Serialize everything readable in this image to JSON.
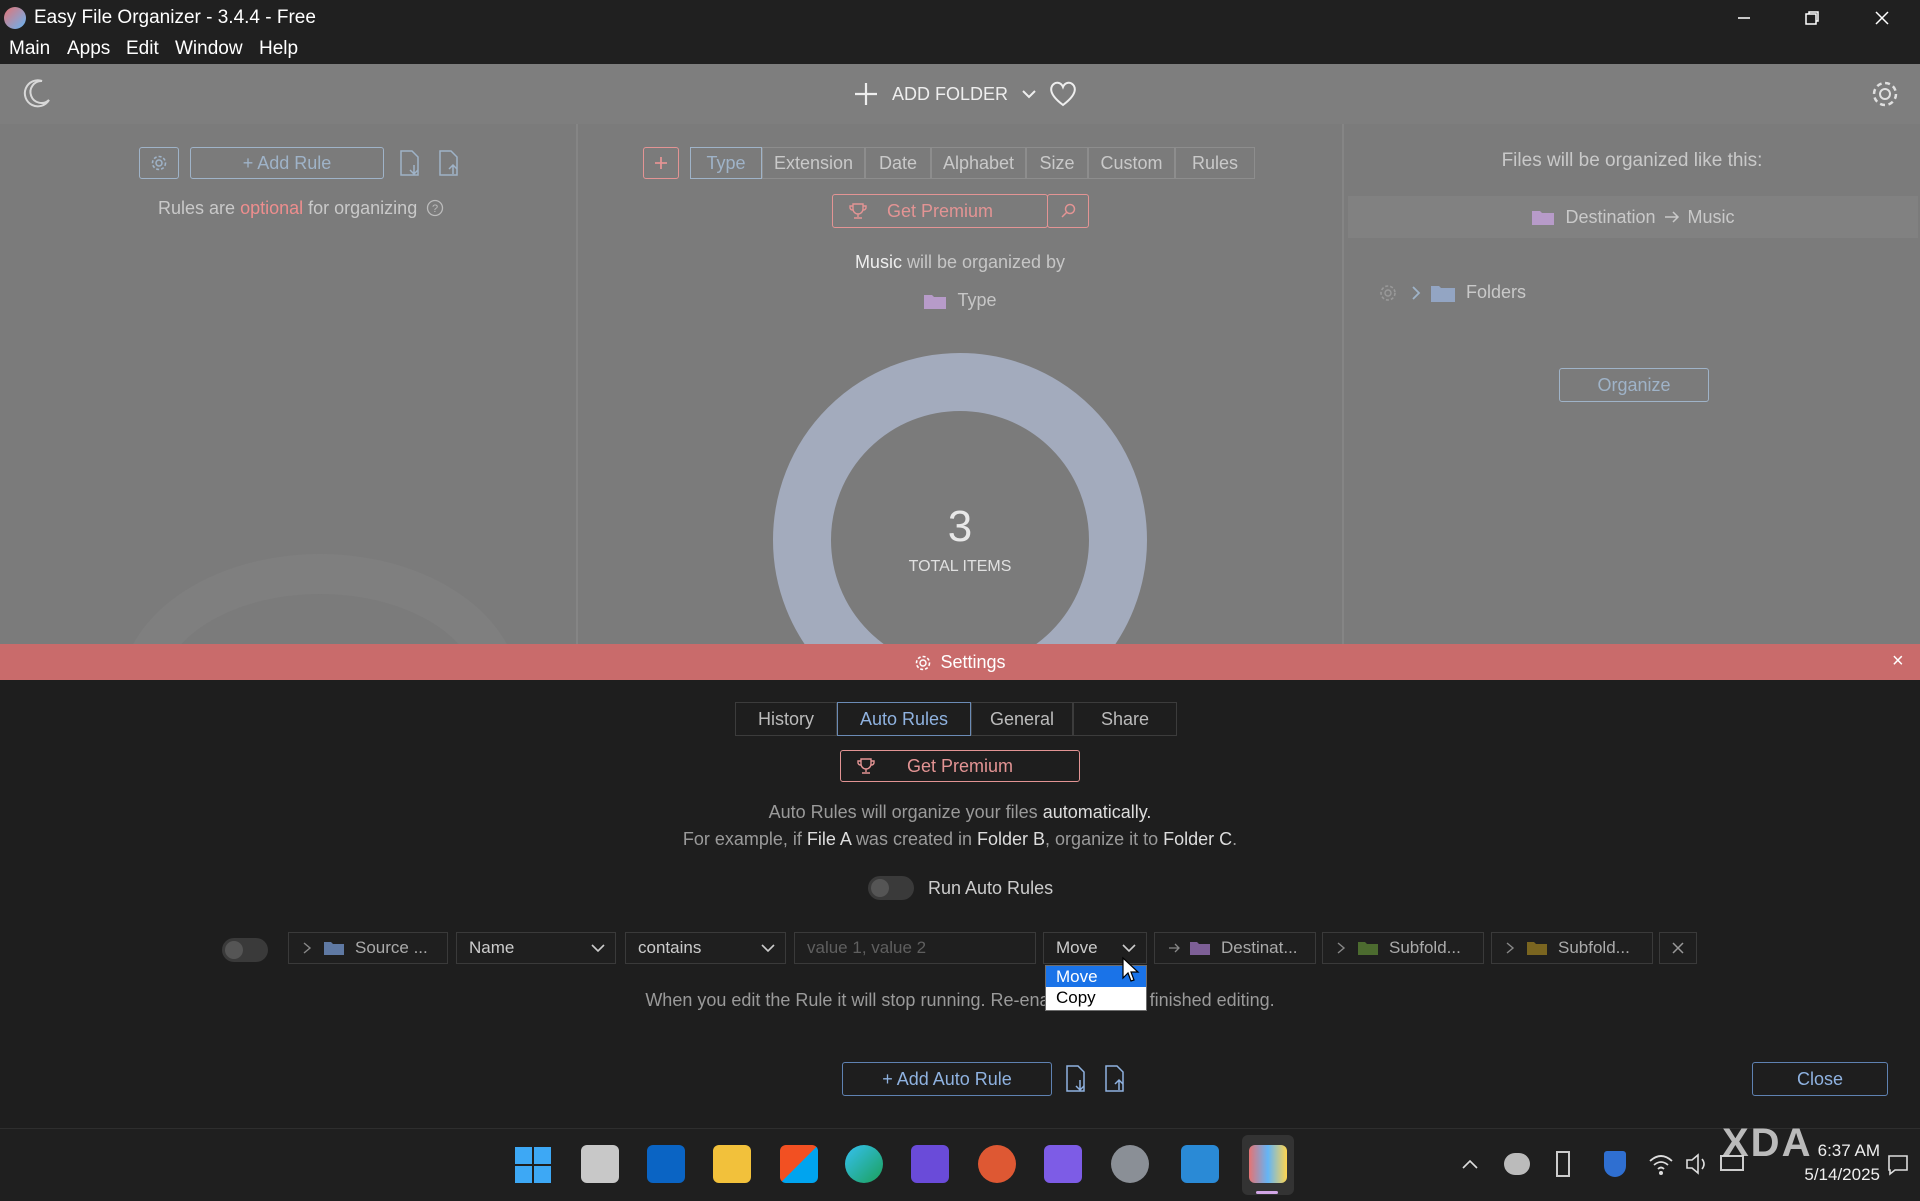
{
  "window": {
    "title": "Easy File Organizer - 3.4.4 - Free"
  },
  "menu": [
    "Main",
    "Apps",
    "Edit",
    "Window",
    "Help"
  ],
  "header": {
    "add_folder": "ADD FOLDER"
  },
  "left_panel": {
    "add_rule": "+ Add Rule",
    "rules_prefix": "Rules are",
    "rules_optional": "optional",
    "rules_suffix": "for organizing"
  },
  "center_panel": {
    "tabs": [
      "Type",
      "Extension",
      "Date",
      "Alphabet",
      "Size",
      "Custom",
      "Rules"
    ],
    "active_tab": "Type",
    "get_premium": "Get Premium",
    "organized_folder": "Music",
    "organized_by_text": "will be organized by",
    "organized_by_value": "Type",
    "total_count": "3",
    "total_label": "TOTAL ITEMS"
  },
  "right_panel": {
    "heading": "Files will be organized like this:",
    "destination": "Destination",
    "destination_sub": "Music",
    "folders": "Folders",
    "organize": "Organize"
  },
  "settings": {
    "title": "Settings",
    "close_x": "×",
    "tabs": [
      "History",
      "Auto Rules",
      "General",
      "Share"
    ],
    "active_tab": "Auto Rules",
    "get_premium": "Get Premium",
    "desc1_prefix": "Auto Rules will organize your files",
    "desc1_bold": "automatically.",
    "desc2_a": "For example, if",
    "desc2_b": "File A",
    "desc2_c": "was created in",
    "desc2_d": "Folder B",
    "desc2_e": ", organize it to",
    "desc2_f": "Folder C",
    "desc2_g": ".",
    "run_auto_rules": "Run Auto Rules",
    "rule": {
      "source": "Source ...",
      "field": "Name",
      "operator": "contains",
      "value_placeholder": "value 1, value 2",
      "action": "Move",
      "destination": "Destinat...",
      "subfolder1": "Subfold...",
      "subfolder2": "Subfold..."
    },
    "dropdown_options": [
      "Move",
      "Copy"
    ],
    "edit_note_a": "When you edit the Rule it will stop running. Re-enable",
    "edit_note_b": "ce finished editing.",
    "add_auto_rule": "+ Add Auto Rule",
    "close": "Close"
  },
  "taskbar": {
    "time": "6:37 AM",
    "date": "5/14/2025",
    "watermark": "XDA"
  }
}
